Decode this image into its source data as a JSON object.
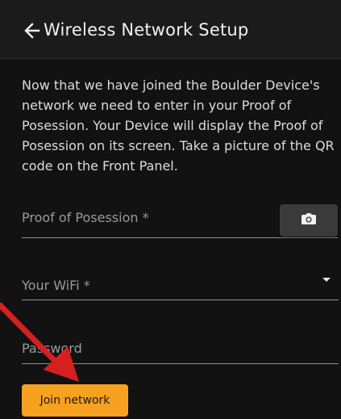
{
  "header": {
    "back_icon": "arrow-left-icon",
    "title": "Wireless Network Setup"
  },
  "main": {
    "description": "Now that we have joined the Boulder Device's network we need to enter in your Proof of Posession. Your Device will display the Proof of Posession on its screen. Take a picture of the QR code on the Front Panel.",
    "fields": {
      "proof_of_possession_label": "Proof of Posession *",
      "wifi_label": "Your WiFi *",
      "password_label": "Password"
    },
    "camera_button_icon": "camera-icon",
    "join_button_label": "Join network"
  },
  "colors": {
    "background": "#121212",
    "header_background": "#1b1b1b",
    "button_accent": "#f6a11f",
    "annotation_arrow": "#d81f1f"
  }
}
